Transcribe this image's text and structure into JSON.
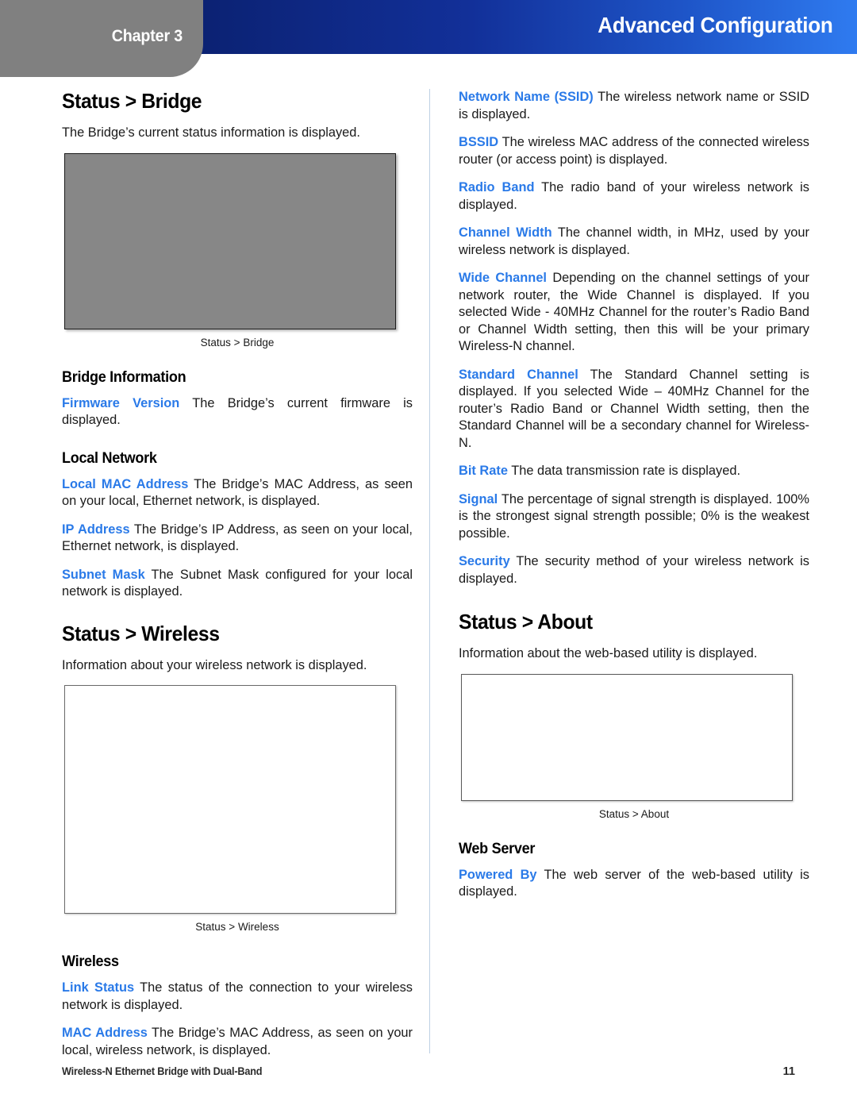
{
  "header": {
    "chapter_label": "Chapter 3",
    "title": "Advanced Configuration",
    "gradient_start": "#0b2171",
    "gradient_end": "#2f7bf0",
    "tab_color": "#808080"
  },
  "colors": {
    "term_blue": "#2a7ae8",
    "divider": "#bed0e4",
    "body_text": "#1a1a1a"
  },
  "left_column": {
    "section_bridge": {
      "heading": "Status > Bridge",
      "intro": "The Bridge’s current status information is displayed.",
      "figure_caption": "Status > Bridge"
    },
    "bridge_information": {
      "heading": "Bridge Information",
      "items": [
        {
          "term": "Firmware Version",
          "desc": " The Bridge’s current firmware is displayed."
        }
      ]
    },
    "local_network": {
      "heading": "Local Network",
      "items": [
        {
          "term": "Local MAC Address",
          "desc": "  The Bridge’s MAC Address, as seen on your local, Ethernet network, is displayed."
        },
        {
          "term": "IP Address",
          "desc": "  The Bridge’s IP Address, as seen on your local, Ethernet network, is displayed."
        },
        {
          "term": "Subnet Mask",
          "desc": "  The Subnet Mask configured for your local network is displayed."
        }
      ]
    },
    "section_wireless": {
      "heading": "Status > Wireless",
      "intro": "Information about your wireless network is displayed.",
      "figure_caption": "Status > Wireless"
    },
    "wireless": {
      "heading": "Wireless",
      "items": [
        {
          "term": "Link Status",
          "desc": "  The status of the connection to your wireless network is displayed."
        },
        {
          "term": "MAC Address",
          "desc": "  The Bridge’s MAC Address, as seen on your local, wireless network, is displayed."
        }
      ]
    }
  },
  "right_column": {
    "wireless_details": [
      {
        "term": "Network Name (SSID)",
        "desc": " The wireless network name or SSID is displayed."
      },
      {
        "term": "BSSID",
        "desc": " The wireless MAC address of the connected wireless router (or access point) is displayed."
      },
      {
        "term": "Radio Band",
        "desc": "  The radio band of your wireless network is displayed."
      },
      {
        "term": "Channel Width",
        "desc": "  The channel width, in MHz, used by your wireless network is displayed."
      },
      {
        "term": "Wide Channel",
        "desc": " Depending on the channel settings of your network router, the Wide Channel is displayed. If you selected Wide - 40MHz Channel for the router’s Radio Band or Channel Width setting, then this will be your primary Wireless-N channel."
      },
      {
        "term": "Standard Channel",
        "desc": " The Standard Channel setting is displayed. If you selected Wide – 40MHz Channel for the router’s Radio Band or Channel Width setting, then the Standard Channel will be a secondary channel for Wireless-N."
      },
      {
        "term": "Bit Rate",
        "desc": "  The data transmission rate is displayed."
      },
      {
        "term": "Signal",
        "desc": " The percentage of signal strength is displayed. 100% is the strongest signal strength possible; 0% is the weakest possible."
      },
      {
        "term": "Security",
        "desc": "  The security method of your wireless network is displayed."
      }
    ],
    "section_about": {
      "heading": "Status > About",
      "intro": "Information about the web-based utility is displayed.",
      "figure_caption": "Status > About"
    },
    "web_server": {
      "heading": "Web Server",
      "items": [
        {
          "term": "Powered By",
          "desc": " The web server of the web-based utility is displayed."
        }
      ]
    }
  },
  "footer": {
    "document_title": "Wireless-N Ethernet Bridge with Dual-Band",
    "page_number": "11"
  }
}
